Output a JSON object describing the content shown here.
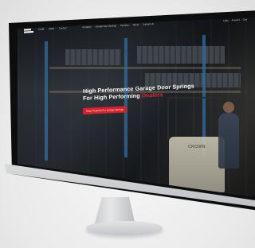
{
  "site": {
    "nav": {
      "small_left": [
        "info@",
        "(800)",
        "Contact"
      ],
      "menu": [
        "Products",
        "Garage Door Springs",
        "Services",
        "About",
        "Contact Us"
      ],
      "right": [
        "Login",
        "Account",
        "Cart"
      ]
    },
    "hero": {
      "title_line1": "High Performance Garage Door Springs",
      "title_line2_prefix": "For High Performing ",
      "title_line2_accent": "Dealers",
      "subtitle": "",
      "bullets": [],
      "cta_label": "Shop Products For Garage Springs"
    },
    "forklift_label": "CROWN"
  },
  "colors": {
    "accent": "#e3262c",
    "cta": "#d8202a",
    "rack": "#2d6fa6"
  }
}
